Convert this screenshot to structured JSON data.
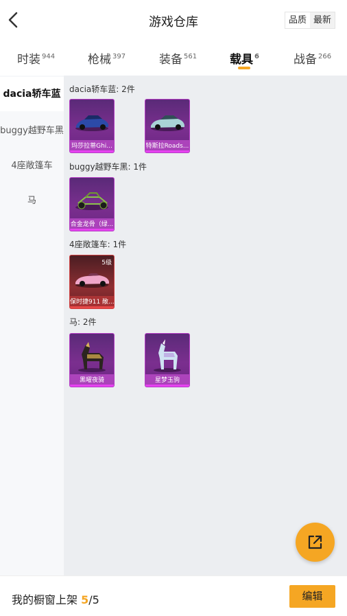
{
  "header": {
    "title": "游戏仓库",
    "sort_options": [
      "品质",
      "最新"
    ],
    "back_icon": "chevron-left-icon"
  },
  "tabs": [
    {
      "label": "时装",
      "count": "944"
    },
    {
      "label": "枪械",
      "count": "397"
    },
    {
      "label": "装备",
      "count": "561"
    },
    {
      "label": "载具",
      "count": "6",
      "active": true
    },
    {
      "label": "战备",
      "count": "266"
    }
  ],
  "sidebar": {
    "items": [
      {
        "label": "dacia轿车蓝",
        "active": true
      },
      {
        "label": "buggy越野车黑"
      },
      {
        "label": "4座敞篷车"
      },
      {
        "label": "马"
      }
    ]
  },
  "groups": [
    {
      "title": "dacia轿车蓝: 2件",
      "items": [
        {
          "name": "玛莎拉蒂Ghi...",
          "icon": "blue-car-icon"
        },
        {
          "name": "特斯拉Roads...",
          "icon": "silver-sportscar-icon"
        }
      ]
    },
    {
      "title": "buggy越野车黑: 1件",
      "items": [
        {
          "name": "合金龙骨（绿...",
          "icon": "buggy-icon"
        }
      ]
    },
    {
      "title": "4座敞篷车: 1件",
      "items": [
        {
          "name": "保时捷911 敞...",
          "level": "5级",
          "icon": "pink-convertible-icon"
        }
      ]
    },
    {
      "title": "马: 2件",
      "items": [
        {
          "name": "黑曜夜骑",
          "icon": "black-horse-icon"
        },
        {
          "name": "星梦玉驹",
          "icon": "crystal-unicorn-icon"
        }
      ]
    }
  ],
  "footer": {
    "label": "我的橱窗上架",
    "current": "5",
    "total": "/5",
    "edit_label": "编辑"
  },
  "colors": {
    "accent": "#f5a623",
    "card_purple": "#7b2f8f",
    "card_red": "#8d2f33"
  }
}
